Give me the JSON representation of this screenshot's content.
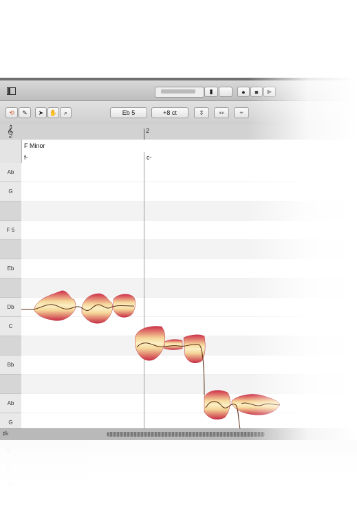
{
  "toolbar": {
    "pitch_value": "Eb 5",
    "cents_value": "+8 ct"
  },
  "ruler": {
    "bar_number": "2"
  },
  "key_signature": "F Minor",
  "chords": [
    "f-",
    "c-"
  ],
  "piano_keys": [
    {
      "label": "Ab",
      "type": "white"
    },
    {
      "label": "G",
      "type": "white"
    },
    {
      "label": "",
      "type": "black"
    },
    {
      "label": "F 5",
      "type": "white"
    },
    {
      "label": "",
      "type": "black"
    },
    {
      "label": "Eb",
      "type": "white"
    },
    {
      "label": "",
      "type": "black"
    },
    {
      "label": "Db",
      "type": "white"
    },
    {
      "label": "C",
      "type": "white"
    },
    {
      "label": "",
      "type": "black"
    },
    {
      "label": "Bb",
      "type": "white"
    },
    {
      "label": "",
      "type": "black"
    },
    {
      "label": "Ab",
      "type": "white"
    },
    {
      "label": "G",
      "type": "white"
    }
  ],
  "colors": {
    "blob_core": "#f7e6a6",
    "blob_edge": "#cf2e46",
    "pitch_line": "#5a2a10"
  }
}
